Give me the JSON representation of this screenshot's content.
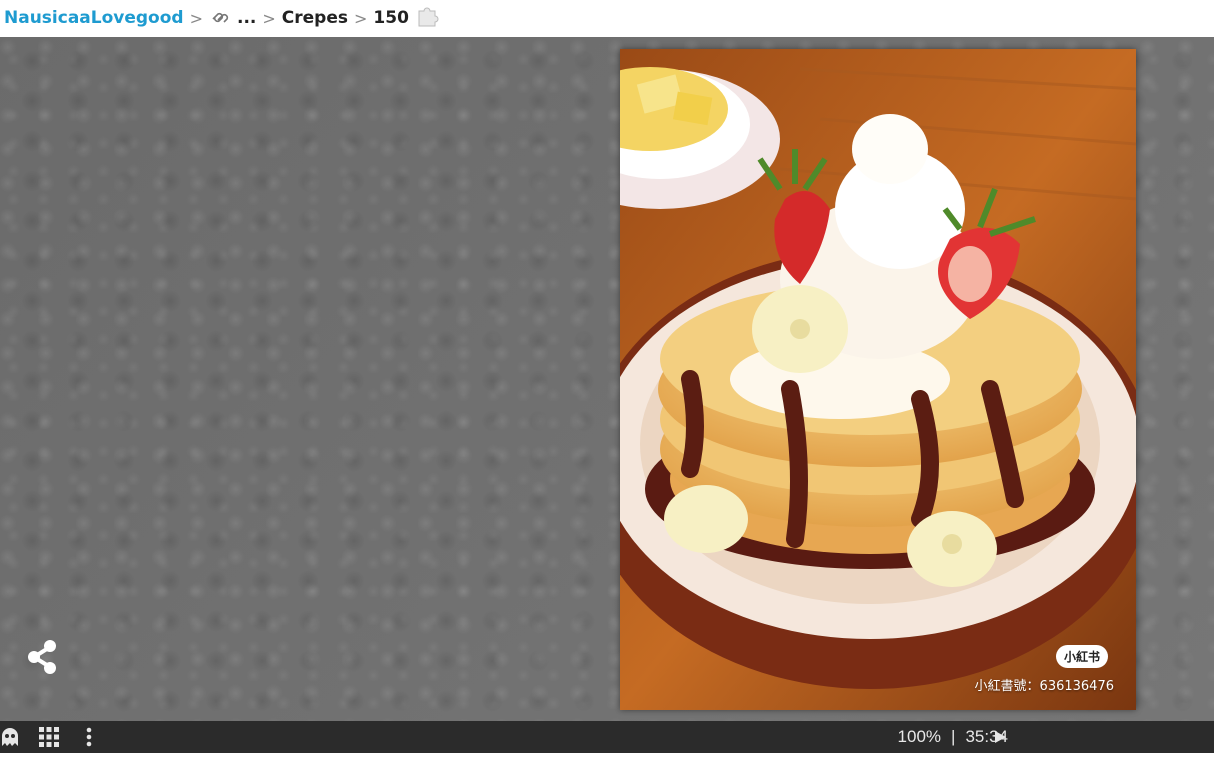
{
  "breadcrumb": {
    "user": "NausicaaLovegood",
    "ellipsis": "...",
    "collection": "Crepes",
    "piece_count": "150"
  },
  "image": {
    "watermark_badge": "小紅书",
    "watermark_text": "小紅書號：636136476"
  },
  "toolbar": {
    "zoom": "100%",
    "divider": "|",
    "timer": "35:34"
  },
  "icons": {
    "link": "link-icon",
    "puzzle": "puzzle-piece-icon",
    "share": "share-icon",
    "ghost": "ghost-icon",
    "grid": "grid-icon",
    "more": "more-vertical-icon",
    "play": "play-icon"
  },
  "colors": {
    "user_link": "#1e9bd0",
    "toolbar_bg": "#2b2b2b",
    "background_texture": "#6e6e6e"
  }
}
